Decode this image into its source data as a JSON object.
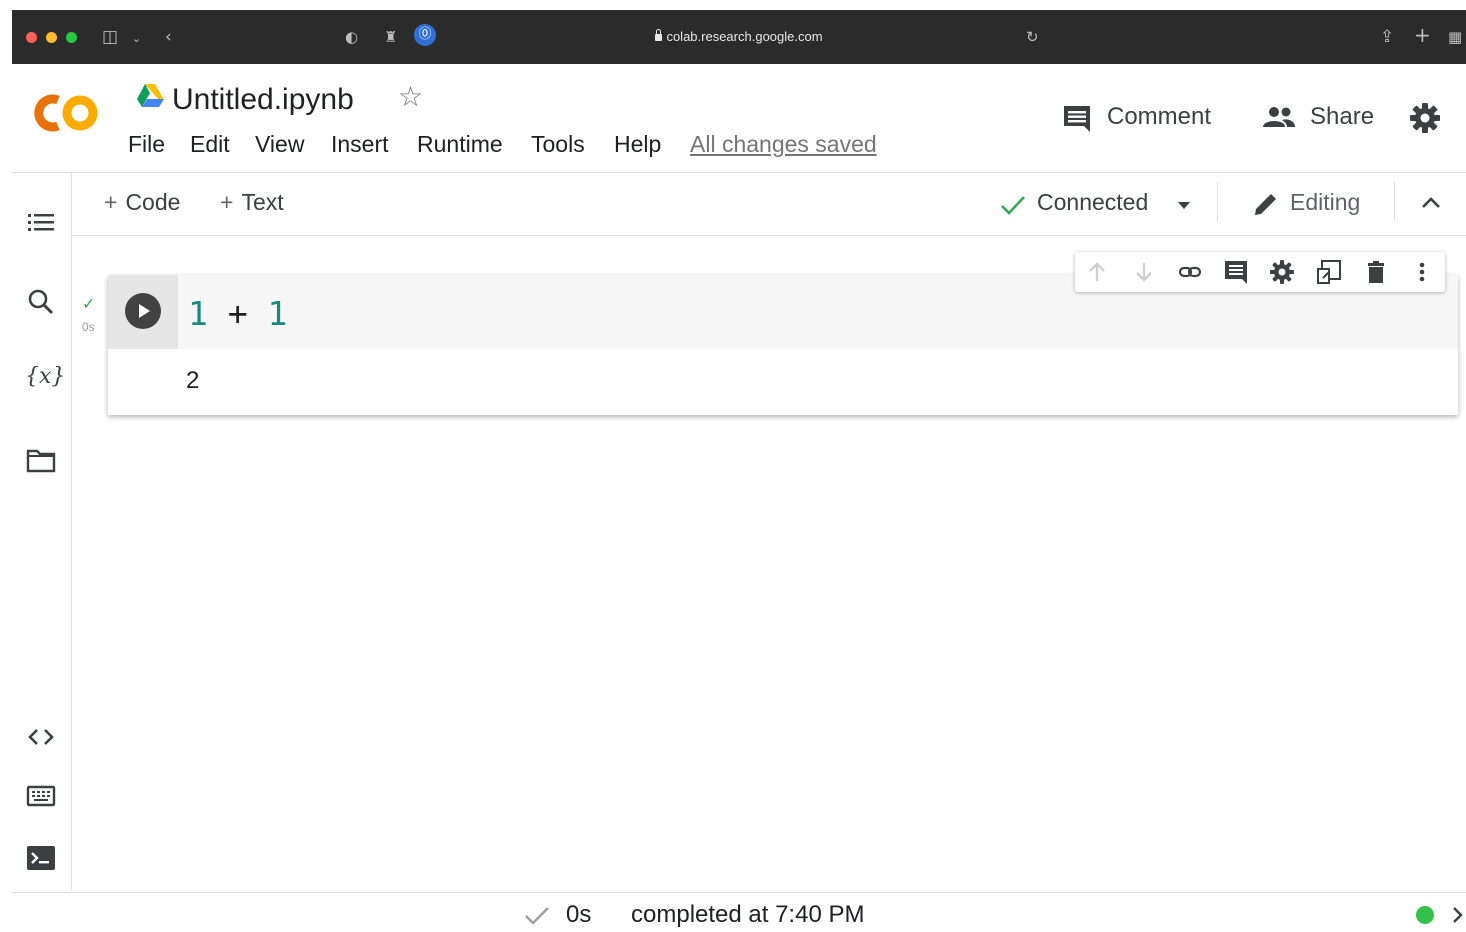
{
  "browser": {
    "url": "colab.research.google.com"
  },
  "header": {
    "logo_text": "CO",
    "title": "Untitled.ipynb",
    "menu": [
      "File",
      "Edit",
      "View",
      "Insert",
      "Runtime",
      "Tools",
      "Help"
    ],
    "saved_status": "All changes saved",
    "comment_label": "Comment",
    "share_label": "Share"
  },
  "toolbar": {
    "add_code_label": "Code",
    "add_text_label": "Text",
    "plus": "+",
    "connection_status": "Connected",
    "mode_label": "Editing"
  },
  "cell": {
    "code_tokens": [
      "1",
      "+",
      "1"
    ],
    "output": "2",
    "exec_time": "0s"
  },
  "status_bar": {
    "duration": "0s",
    "completed_text": "completed at 7:40 PM"
  },
  "colors": {
    "logo_orange": "#f9ab00",
    "logo_orange_dark": "#e8710a",
    "code_number": "#1a8a7a",
    "connected_check": "#34a853",
    "status_dot": "#34c04a",
    "browser_bar": "#2b2b2b"
  },
  "icons": {
    "rail_top": [
      "table-of-contents-icon",
      "search-icon",
      "variables-icon",
      "files-icon"
    ],
    "rail_bottom": [
      "code-snippets-icon",
      "command-palette-icon",
      "terminal-icon"
    ],
    "cell_toolbar": [
      "move-up-icon",
      "move-down-icon",
      "link-icon",
      "comment-icon",
      "settings-icon",
      "mirror-cell-icon",
      "delete-icon",
      "more-vert-icon"
    ]
  }
}
